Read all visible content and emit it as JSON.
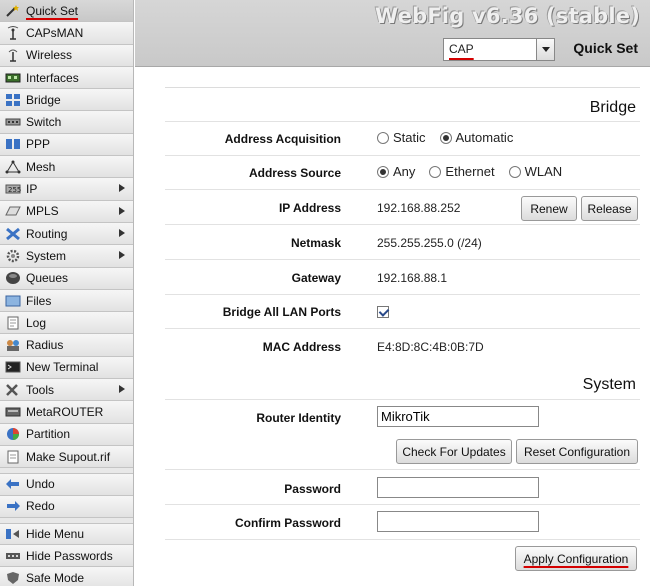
{
  "app": {
    "title": "WebFig v6.36 (stable)"
  },
  "header": {
    "mode_value": "CAP",
    "page_title": "Quick Set"
  },
  "sidebar": {
    "items": [
      {
        "label": "Quick Set",
        "icon": "wand-icon",
        "has_submenu": false,
        "active": true
      },
      {
        "label": "CAPsMAN",
        "icon": "antenna-icon",
        "has_submenu": false
      },
      {
        "label": "Wireless",
        "icon": "wireless-icon",
        "has_submenu": false
      },
      {
        "label": "Interfaces",
        "icon": "interfaces-icon",
        "has_submenu": false
      },
      {
        "label": "Bridge",
        "icon": "bridge-icon",
        "has_submenu": false
      },
      {
        "label": "Switch",
        "icon": "switch-icon",
        "has_submenu": false
      },
      {
        "label": "PPP",
        "icon": "ppp-icon",
        "has_submenu": false
      },
      {
        "label": "Mesh",
        "icon": "mesh-icon",
        "has_submenu": false
      },
      {
        "label": "IP",
        "icon": "ip-icon",
        "has_submenu": true
      },
      {
        "label": "MPLS",
        "icon": "mpls-icon",
        "has_submenu": true
      },
      {
        "label": "Routing",
        "icon": "routing-icon",
        "has_submenu": true
      },
      {
        "label": "System",
        "icon": "gear-icon",
        "has_submenu": true
      },
      {
        "label": "Queues",
        "icon": "queues-icon",
        "has_submenu": false
      },
      {
        "label": "Files",
        "icon": "folder-icon",
        "has_submenu": false
      },
      {
        "label": "Log",
        "icon": "log-icon",
        "has_submenu": false
      },
      {
        "label": "Radius",
        "icon": "radius-icon",
        "has_submenu": false
      },
      {
        "label": "New Terminal",
        "icon": "terminal-icon",
        "has_submenu": false
      },
      {
        "label": "Tools",
        "icon": "tools-icon",
        "has_submenu": true
      },
      {
        "label": "MetaROUTER",
        "icon": "metarouter-icon",
        "has_submenu": false
      },
      {
        "label": "Partition",
        "icon": "partition-icon",
        "has_submenu": false
      },
      {
        "label": "Make Supout.rif",
        "icon": "supout-icon",
        "has_submenu": false
      }
    ],
    "actions": [
      {
        "label": "Undo",
        "icon": "undo-icon"
      },
      {
        "label": "Redo",
        "icon": "redo-icon"
      }
    ],
    "footer": [
      {
        "label": "Hide Menu",
        "icon": "hide-menu-icon"
      },
      {
        "label": "Hide Passwords",
        "icon": "hide-passwords-icon"
      },
      {
        "label": "Safe Mode",
        "icon": "safe-mode-icon"
      }
    ]
  },
  "bridge": {
    "section_title": "Bridge",
    "address_acquisition": {
      "label": "Address Acquisition",
      "options": [
        "Static",
        "Automatic"
      ],
      "selected": "Automatic"
    },
    "address_source": {
      "label": "Address Source",
      "options": [
        "Any",
        "Ethernet",
        "WLAN"
      ],
      "selected": "Any"
    },
    "ip_address": {
      "label": "IP Address",
      "value": "192.168.88.252",
      "renew_label": "Renew",
      "release_label": "Release"
    },
    "netmask": {
      "label": "Netmask",
      "value": "255.255.255.0 (/24)"
    },
    "gateway": {
      "label": "Gateway",
      "value": "192.168.88.1"
    },
    "bridge_all_lan_ports": {
      "label": "Bridge All LAN Ports",
      "checked": true
    },
    "mac_address": {
      "label": "MAC Address",
      "value": "E4:8D:8C:4B:0B:7D"
    }
  },
  "system": {
    "section_title": "System",
    "router_identity": {
      "label": "Router Identity",
      "value": "MikroTik"
    },
    "check_updates_label": "Check For Updates",
    "reset_config_label": "Reset Configuration",
    "password": {
      "label": "Password",
      "value": ""
    },
    "confirm_password": {
      "label": "Confirm Password",
      "value": ""
    },
    "apply_label": "Apply Configuration"
  },
  "colors": {
    "annotation_red": "#d40000",
    "sidebar_bg": "#e8e8e8",
    "header_bg": "#cfcfcf"
  }
}
